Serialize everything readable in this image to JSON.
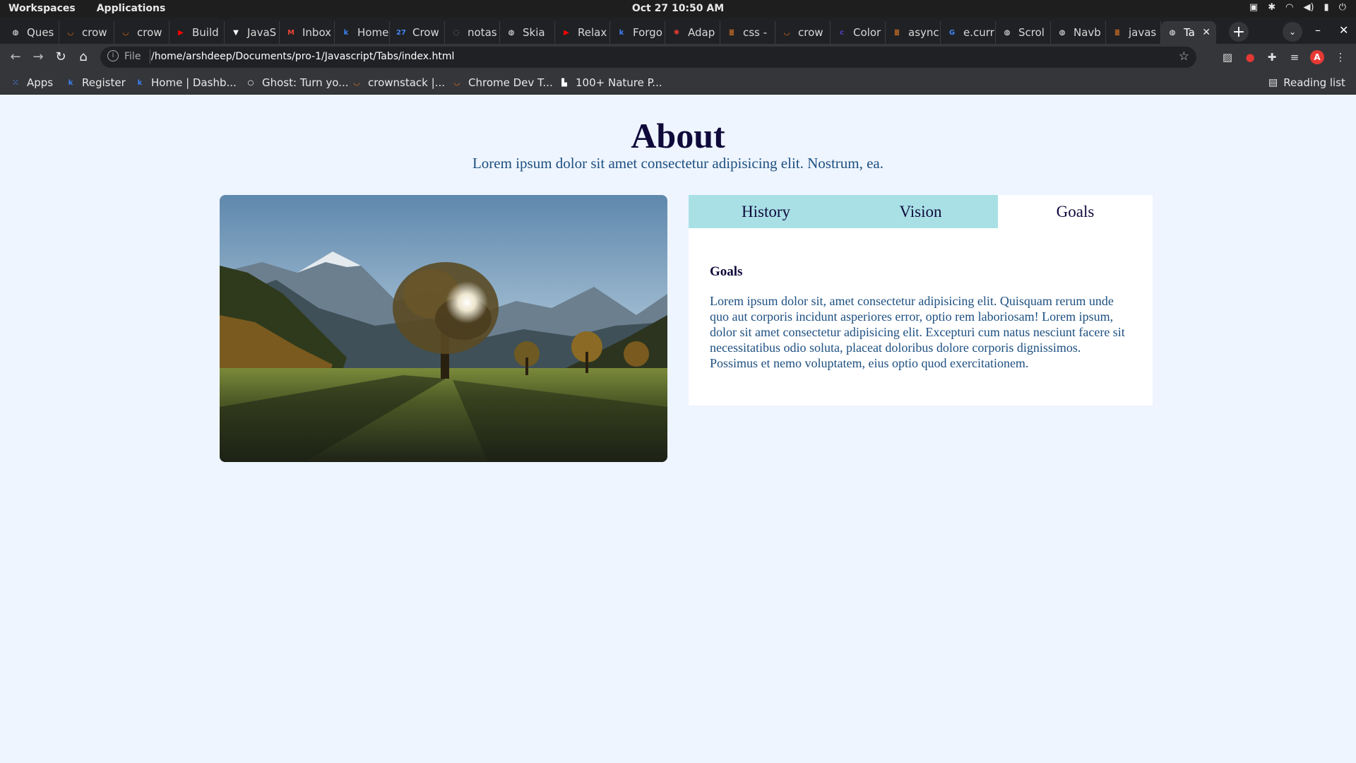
{
  "os": {
    "workspaces": "Workspaces",
    "applications": "Applications",
    "clock": "Oct 27  10:50 AM"
  },
  "browser": {
    "tabs": [
      {
        "label": "Ques",
        "icon": "generic-globe-icon",
        "color": "#ffffff"
      },
      {
        "label": "crow",
        "icon": "crownstack-icon",
        "color": "#ff7a1a"
      },
      {
        "label": "crow",
        "icon": "crownstack-icon",
        "color": "#ff7a1a"
      },
      {
        "label": "Build",
        "icon": "youtube-icon",
        "color": "#ff0000"
      },
      {
        "label": "JavaS",
        "icon": "bookmark-icon",
        "color": "#ffffff"
      },
      {
        "label": "Inbox",
        "icon": "gmail-icon",
        "color": "#ea4335"
      },
      {
        "label": "Home",
        "icon": "k-icon",
        "color": "#3b82f6"
      },
      {
        "label": "Crow",
        "icon": "calendar-icon",
        "color": "#4285f4"
      },
      {
        "label": "notas",
        "icon": "loading-icon",
        "color": "#888888"
      },
      {
        "label": "Skia",
        "icon": "generic-globe-icon",
        "color": "#ffffff"
      },
      {
        "label": "Relax",
        "icon": "youtube-icon",
        "color": "#ff0000"
      },
      {
        "label": "Forgo",
        "icon": "k-icon",
        "color": "#3b82f6"
      },
      {
        "label": "Adap",
        "icon": "asterisk-icon",
        "color": "#e53935"
      },
      {
        "label": "css -",
        "icon": "stackoverflow-icon",
        "color": "#f48024"
      },
      {
        "label": "crow",
        "icon": "crownstack-icon",
        "color": "#ff7a1a"
      },
      {
        "label": "Color",
        "icon": "c-icon",
        "color": "#5b3cc4"
      },
      {
        "label": "async",
        "icon": "stackoverflow-icon",
        "color": "#f48024"
      },
      {
        "label": "e.curr",
        "icon": "google-icon",
        "color": "#4285f4"
      },
      {
        "label": "Scrol",
        "icon": "generic-globe-icon",
        "color": "#ffffff"
      },
      {
        "label": "Navb",
        "icon": "generic-globe-icon",
        "color": "#ffffff"
      },
      {
        "label": "javas",
        "icon": "stackoverflow-icon",
        "color": "#f48024"
      },
      {
        "label": "Ta",
        "icon": "generic-globe-icon",
        "color": "#ffffff",
        "active": true
      }
    ],
    "address": {
      "scheme": "File",
      "url": "/home/arshdeep/Documents/pro-1/Javascript/Tabs/index.html"
    },
    "bookmarks": [
      {
        "label": "Apps",
        "icon": "apps-grid-icon",
        "color": "#4285f4"
      },
      {
        "label": "Register",
        "icon": "k-icon",
        "color": "#3b82f6"
      },
      {
        "label": "Home | Dashb...",
        "icon": "k-icon",
        "color": "#3b82f6"
      },
      {
        "label": "Ghost: Turn yo...",
        "icon": "ghost-icon",
        "color": "#ffffff"
      },
      {
        "label": "crownstack |...",
        "icon": "crownstack-icon",
        "color": "#ff7a1a"
      },
      {
        "label": "Chrome Dev T...",
        "icon": "crownstack-icon",
        "color": "#ff7a1a"
      },
      {
        "label": "100+ Nature P...",
        "icon": "unsplash-icon",
        "color": "#ffffff"
      }
    ],
    "reading_list": "Reading list"
  },
  "page": {
    "title": "About",
    "subtitle": "Lorem ipsum dolor sit amet consectetur adipisicing elit. Nostrum, ea.",
    "tabs": [
      "History",
      "Vision",
      "Goals"
    ],
    "active_tab": "Goals",
    "content_heading": "Goals",
    "content_text": "Lorem ipsum dolor sit, amet consectetur adipisicing elit. Quisquam rerum unde quo aut corporis incidunt asperiores error, optio rem laboriosam! Lorem ipsum, dolor sit amet consectetur adipisicing elit. Excepturi cum natus nesciunt facere sit necessitatibus odio soluta, placeat doloribus dolore corporis dignissimos. Possimus et nemo voluptatem, eius optio quod exercitationem."
  },
  "colors": {
    "page_bg": "#eef5ff",
    "heading": "#0f0a3a",
    "text": "#1d4f80",
    "tab_inactive": "#a8e0e6",
    "tab_active": "#ffffff"
  }
}
